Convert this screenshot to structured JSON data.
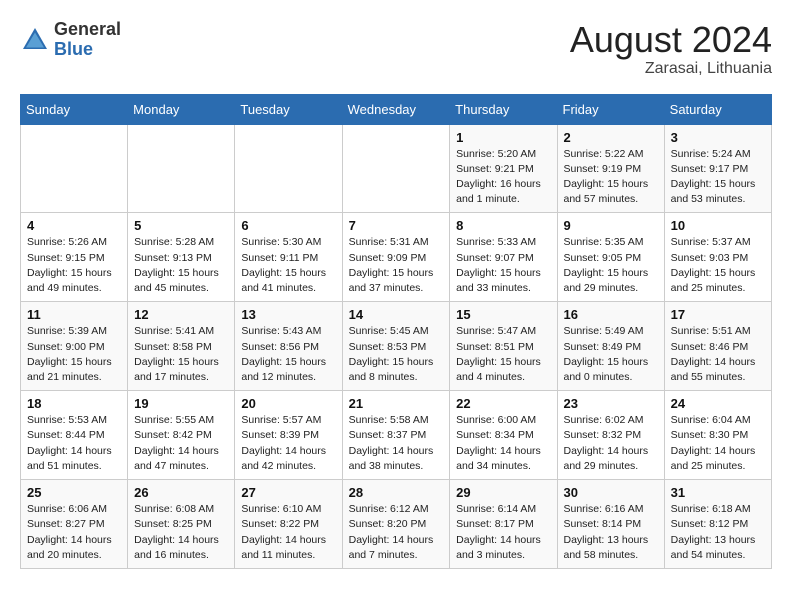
{
  "header": {
    "logo_general": "General",
    "logo_blue": "Blue",
    "month_year": "August 2024",
    "location": "Zarasai, Lithuania"
  },
  "weekdays": [
    "Sunday",
    "Monday",
    "Tuesday",
    "Wednesday",
    "Thursday",
    "Friday",
    "Saturday"
  ],
  "weeks": [
    [
      {
        "day": "",
        "info": ""
      },
      {
        "day": "",
        "info": ""
      },
      {
        "day": "",
        "info": ""
      },
      {
        "day": "",
        "info": ""
      },
      {
        "day": "1",
        "info": "Sunrise: 5:20 AM\nSunset: 9:21 PM\nDaylight: 16 hours\nand 1 minute."
      },
      {
        "day": "2",
        "info": "Sunrise: 5:22 AM\nSunset: 9:19 PM\nDaylight: 15 hours\nand 57 minutes."
      },
      {
        "day": "3",
        "info": "Sunrise: 5:24 AM\nSunset: 9:17 PM\nDaylight: 15 hours\nand 53 minutes."
      }
    ],
    [
      {
        "day": "4",
        "info": "Sunrise: 5:26 AM\nSunset: 9:15 PM\nDaylight: 15 hours\nand 49 minutes."
      },
      {
        "day": "5",
        "info": "Sunrise: 5:28 AM\nSunset: 9:13 PM\nDaylight: 15 hours\nand 45 minutes."
      },
      {
        "day": "6",
        "info": "Sunrise: 5:30 AM\nSunset: 9:11 PM\nDaylight: 15 hours\nand 41 minutes."
      },
      {
        "day": "7",
        "info": "Sunrise: 5:31 AM\nSunset: 9:09 PM\nDaylight: 15 hours\nand 37 minutes."
      },
      {
        "day": "8",
        "info": "Sunrise: 5:33 AM\nSunset: 9:07 PM\nDaylight: 15 hours\nand 33 minutes."
      },
      {
        "day": "9",
        "info": "Sunrise: 5:35 AM\nSunset: 9:05 PM\nDaylight: 15 hours\nand 29 minutes."
      },
      {
        "day": "10",
        "info": "Sunrise: 5:37 AM\nSunset: 9:03 PM\nDaylight: 15 hours\nand 25 minutes."
      }
    ],
    [
      {
        "day": "11",
        "info": "Sunrise: 5:39 AM\nSunset: 9:00 PM\nDaylight: 15 hours\nand 21 minutes."
      },
      {
        "day": "12",
        "info": "Sunrise: 5:41 AM\nSunset: 8:58 PM\nDaylight: 15 hours\nand 17 minutes."
      },
      {
        "day": "13",
        "info": "Sunrise: 5:43 AM\nSunset: 8:56 PM\nDaylight: 15 hours\nand 12 minutes."
      },
      {
        "day": "14",
        "info": "Sunrise: 5:45 AM\nSunset: 8:53 PM\nDaylight: 15 hours\nand 8 minutes."
      },
      {
        "day": "15",
        "info": "Sunrise: 5:47 AM\nSunset: 8:51 PM\nDaylight: 15 hours\nand 4 minutes."
      },
      {
        "day": "16",
        "info": "Sunrise: 5:49 AM\nSunset: 8:49 PM\nDaylight: 15 hours\nand 0 minutes."
      },
      {
        "day": "17",
        "info": "Sunrise: 5:51 AM\nSunset: 8:46 PM\nDaylight: 14 hours\nand 55 minutes."
      }
    ],
    [
      {
        "day": "18",
        "info": "Sunrise: 5:53 AM\nSunset: 8:44 PM\nDaylight: 14 hours\nand 51 minutes."
      },
      {
        "day": "19",
        "info": "Sunrise: 5:55 AM\nSunset: 8:42 PM\nDaylight: 14 hours\nand 47 minutes."
      },
      {
        "day": "20",
        "info": "Sunrise: 5:57 AM\nSunset: 8:39 PM\nDaylight: 14 hours\nand 42 minutes."
      },
      {
        "day": "21",
        "info": "Sunrise: 5:58 AM\nSunset: 8:37 PM\nDaylight: 14 hours\nand 38 minutes."
      },
      {
        "day": "22",
        "info": "Sunrise: 6:00 AM\nSunset: 8:34 PM\nDaylight: 14 hours\nand 34 minutes."
      },
      {
        "day": "23",
        "info": "Sunrise: 6:02 AM\nSunset: 8:32 PM\nDaylight: 14 hours\nand 29 minutes."
      },
      {
        "day": "24",
        "info": "Sunrise: 6:04 AM\nSunset: 8:30 PM\nDaylight: 14 hours\nand 25 minutes."
      }
    ],
    [
      {
        "day": "25",
        "info": "Sunrise: 6:06 AM\nSunset: 8:27 PM\nDaylight: 14 hours\nand 20 minutes."
      },
      {
        "day": "26",
        "info": "Sunrise: 6:08 AM\nSunset: 8:25 PM\nDaylight: 14 hours\nand 16 minutes."
      },
      {
        "day": "27",
        "info": "Sunrise: 6:10 AM\nSunset: 8:22 PM\nDaylight: 14 hours\nand 11 minutes."
      },
      {
        "day": "28",
        "info": "Sunrise: 6:12 AM\nSunset: 8:20 PM\nDaylight: 14 hours\nand 7 minutes."
      },
      {
        "day": "29",
        "info": "Sunrise: 6:14 AM\nSunset: 8:17 PM\nDaylight: 14 hours\nand 3 minutes."
      },
      {
        "day": "30",
        "info": "Sunrise: 6:16 AM\nSunset: 8:14 PM\nDaylight: 13 hours\nand 58 minutes."
      },
      {
        "day": "31",
        "info": "Sunrise: 6:18 AM\nSunset: 8:12 PM\nDaylight: 13 hours\nand 54 minutes."
      }
    ]
  ]
}
